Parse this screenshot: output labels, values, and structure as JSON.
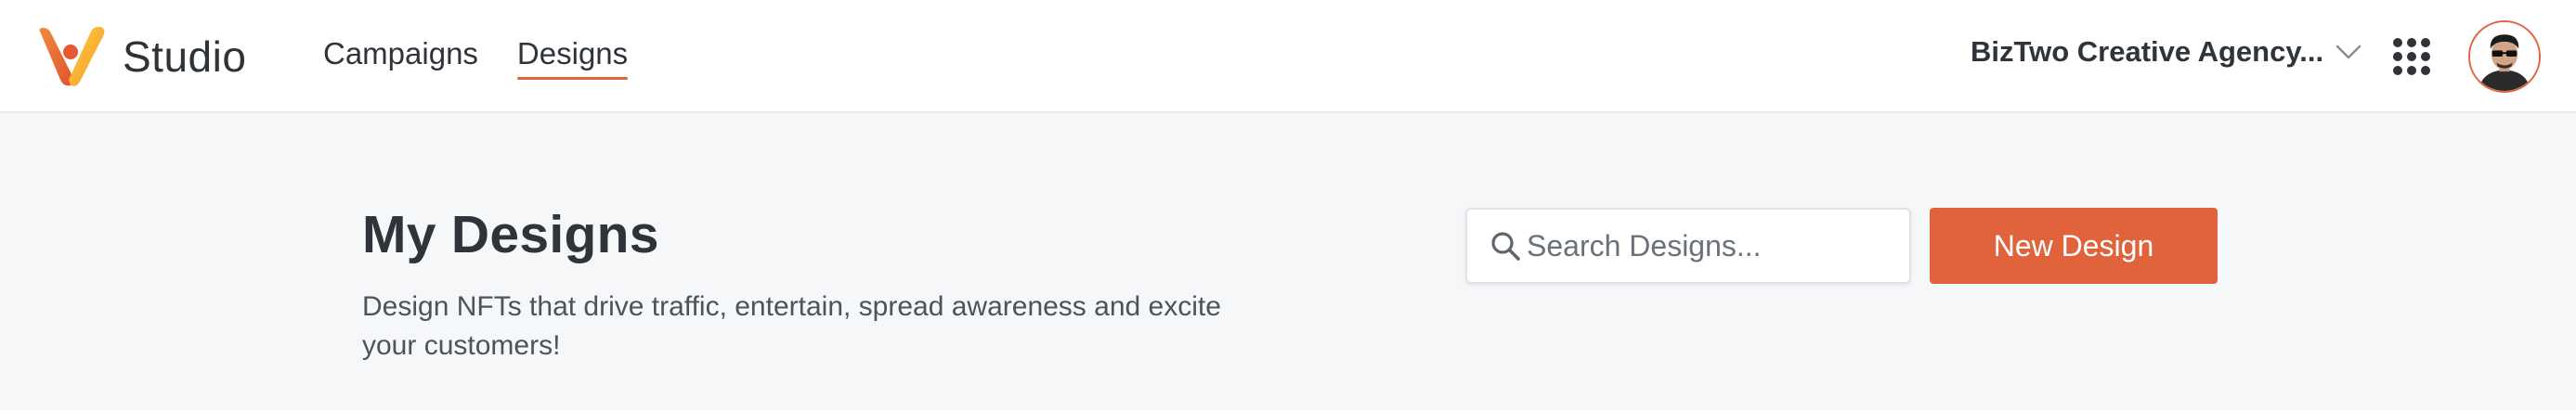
{
  "brand": {
    "name": "Studio",
    "logo_icon": "studio-v-logo-icon"
  },
  "nav": {
    "items": [
      {
        "label": "Campaigns",
        "active": false
      },
      {
        "label": "Designs",
        "active": true
      }
    ]
  },
  "account": {
    "name": "BizTwo Creative Agency...",
    "dropdown_icon": "chevron-down-icon"
  },
  "apps_icon": "apps-grid-icon",
  "avatar_icon": "user-avatar",
  "page": {
    "title": "My Designs",
    "subtitle": "Design NFTs that drive traffic, entertain, spread awareness and excite your customers!"
  },
  "search": {
    "placeholder": "Search Designs...",
    "value": "",
    "icon": "search-icon"
  },
  "actions": {
    "new_design_label": "New Design"
  },
  "colors": {
    "accent": "#e0633c",
    "background": "#f6f7f9",
    "header_background": "#ffffff",
    "text": "#2f343a"
  }
}
